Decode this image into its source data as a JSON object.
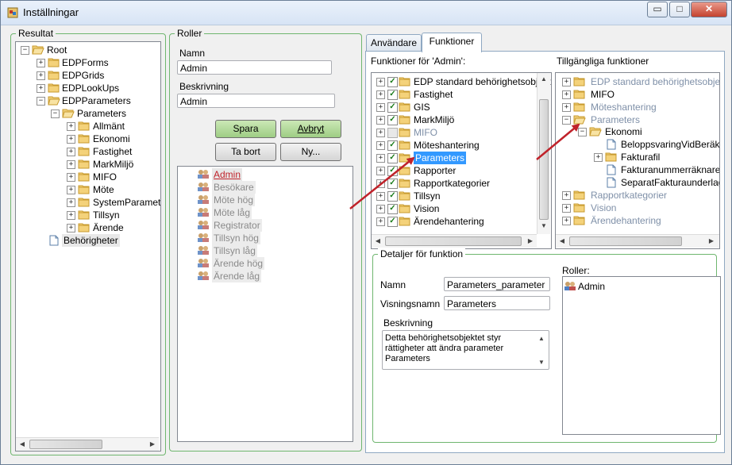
{
  "window": {
    "title": "Inställningar",
    "min": "▭",
    "max": "□",
    "close": "✕"
  },
  "left": {
    "group_label": "Resultat",
    "tree": {
      "root": "Root",
      "items": [
        "EDPForms",
        "EDPGrids",
        "EDPLookUps",
        "EDPParameters"
      ],
      "params_node": "Parameters",
      "params_children": [
        "Allmänt",
        "Ekonomi",
        "Fastighet",
        "MarkMiljö",
        "MIFO",
        "Möte",
        "SystemParametrar",
        "Tillsyn",
        "Ärende"
      ],
      "doc": "Behörigheter"
    }
  },
  "roles": {
    "group_label": "Roller",
    "name_label": "Namn",
    "name_value": "Admin",
    "desc_label": "Beskrivning",
    "desc_value": "Admin",
    "save": "Spara",
    "cancel": "Avbryt",
    "delete": "Ta bort",
    "new": "Ny...",
    "list": [
      "Admin",
      "Besökare",
      "Möte hög",
      "Möte låg",
      "Registrator",
      "Tillsyn hög",
      "Tillsyn låg",
      "Ärende hög",
      "Ärende låg"
    ]
  },
  "tabs": {
    "users": "Användare",
    "functions": "Funktioner"
  },
  "functions": {
    "left_header": "Funktioner för 'Admin':",
    "right_header": "Tillgängliga funktioner",
    "left_items": [
      {
        "label": "EDP standard behörighetsobjekt",
        "checked": true
      },
      {
        "label": "Fastighet",
        "checked": true
      },
      {
        "label": "GIS",
        "checked": true
      },
      {
        "label": "MarkMiljö",
        "checked": true
      },
      {
        "label": "MIFO",
        "checked": false
      },
      {
        "label": "Möteshantering",
        "checked": true
      },
      {
        "label": "Parameters",
        "checked": true
      },
      {
        "label": "Rapporter",
        "checked": true
      },
      {
        "label": "Rapportkategorier",
        "checked": true
      },
      {
        "label": "Tillsyn",
        "checked": true
      },
      {
        "label": "Vision",
        "checked": true
      },
      {
        "label": "Ärendehantering",
        "checked": true
      }
    ],
    "right_items": {
      "top": [
        "EDP standard behörighetsobjekt",
        "MIFO",
        "Möteshantering",
        "Parameters"
      ],
      "ekonomi": "Ekonomi",
      "ekonomi_children": [
        "BeloppsvaringVidBeräkn",
        "Fakturafil",
        "Fakturanummerräknare",
        "SeparatFakturaunderlag"
      ],
      "bottom": [
        "Rapportkategorier",
        "Vision",
        "Ärendehantering"
      ]
    }
  },
  "details": {
    "group_label": "Detaljer för funktion",
    "name_label": "Namn",
    "name_value": "Parameters_parameter",
    "display_label": "Visningsnamn",
    "display_value": "Parameters",
    "desc_label": "Beskrivning",
    "desc_text": "Detta behörighetsobjektet styr rättigheter att ändra parameter Parameters",
    "roles_label": "Roller:",
    "roles_item": "Admin"
  },
  "colors": {
    "accent_green": "#6fb66f",
    "selection": "#3399ff",
    "arrow": "#c0222a"
  }
}
